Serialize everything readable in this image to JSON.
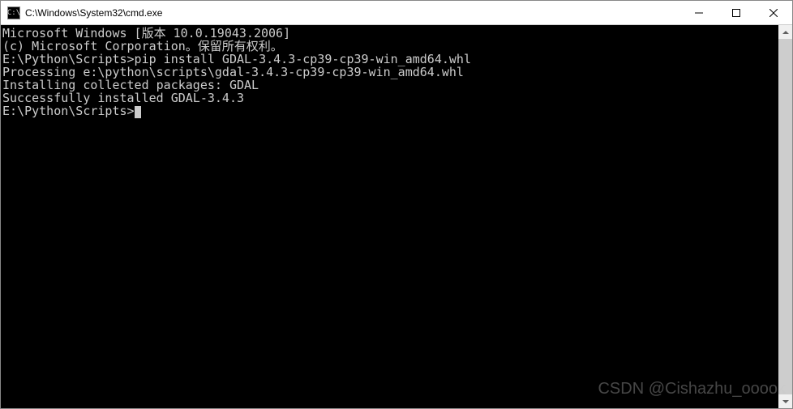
{
  "window": {
    "icon_label": "C:\\",
    "title": "C:\\Windows\\System32\\cmd.exe"
  },
  "terminal": {
    "lines": [
      "Microsoft Windows [版本 10.0.19043.2006]",
      "(c) Microsoft Corporation。保留所有权利。",
      "",
      "E:\\Python\\Scripts>pip install GDAL-3.4.3-cp39-cp39-win_amd64.whl",
      "Processing e:\\python\\scripts\\gdal-3.4.3-cp39-cp39-win_amd64.whl",
      "Installing collected packages: GDAL",
      "Successfully installed GDAL-3.4.3",
      "",
      "E:\\Python\\Scripts>"
    ]
  },
  "watermark": "CSDN @Cishazhu_ooook"
}
